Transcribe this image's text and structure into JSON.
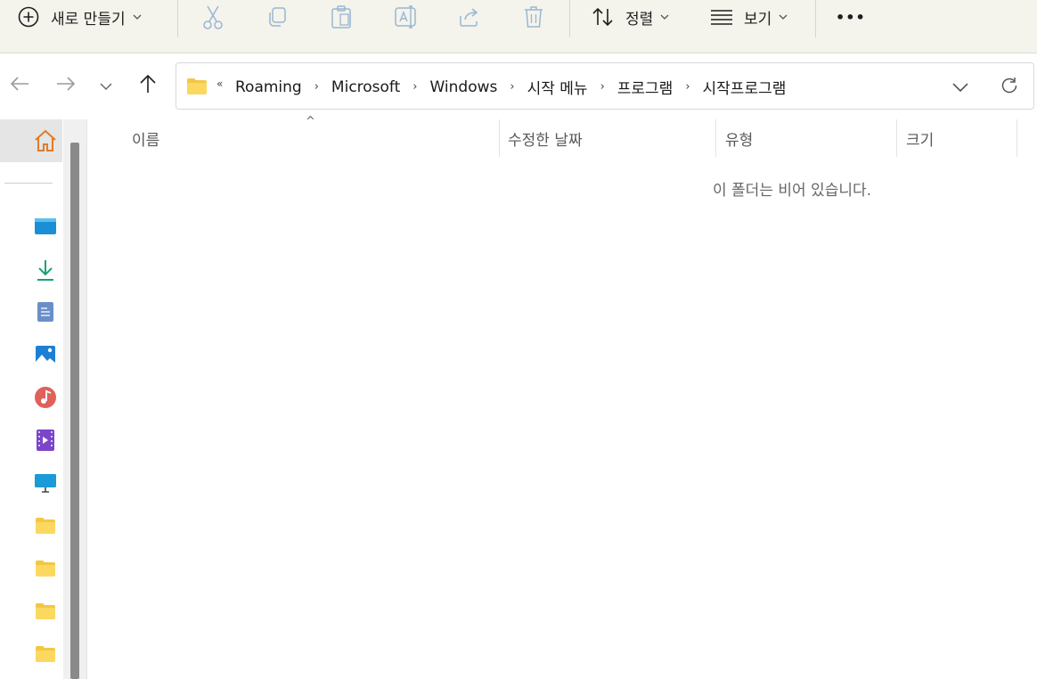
{
  "toolbar": {
    "new_label": "새로 만들기",
    "sort_label": "정렬",
    "view_label": "보기",
    "more_label": "•••"
  },
  "address": {
    "overflow_label": "«",
    "crumbs": [
      "Roaming",
      "Microsoft",
      "Windows",
      "시작 메뉴",
      "프로그램",
      "시작프로그램"
    ],
    "separator": "›"
  },
  "columns": {
    "name": "이름",
    "modified": "수정한 날짜",
    "type": "유형",
    "size": "크기"
  },
  "sort_indicator": "^",
  "empty_message": "이 폴더는 비어 있습니다.",
  "colors": {
    "toolbar_bg": "#f4f3ec",
    "home_icon": "#e07b2a",
    "folder": "#f3c745",
    "scroll_thumb": "#8a8a8a"
  }
}
